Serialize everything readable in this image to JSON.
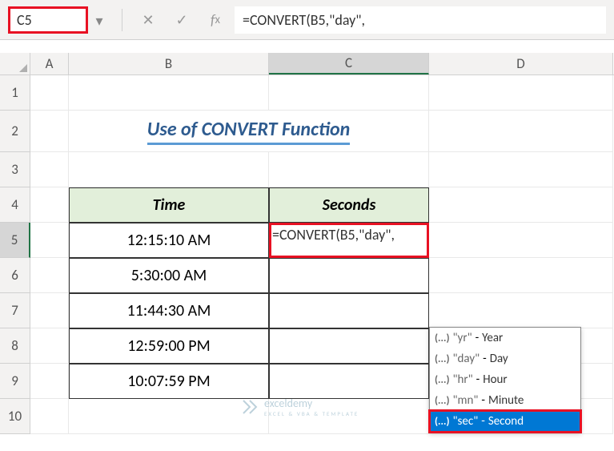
{
  "name_box": "C5",
  "formula_bar": "=CONVERT(B5,\"day\",",
  "columns": {
    "a": "A",
    "b": "B",
    "c": "C",
    "d": "D"
  },
  "rows": {
    "r1": "1",
    "r2": "2",
    "r3": "3",
    "r4": "4",
    "r5": "5",
    "r6": "6",
    "r7": "7",
    "r8": "8",
    "r9": "9",
    "r10": "10"
  },
  "title": "Use of CONVERT Function",
  "table": {
    "headers": {
      "time": "Time",
      "seconds": "Seconds"
    },
    "rows": [
      {
        "time": "12:15:10 AM",
        "seconds": ""
      },
      {
        "time": "5:30:00 AM",
        "seconds": ""
      },
      {
        "time": "11:44:30 AM",
        "seconds": ""
      },
      {
        "time": "12:59:00 PM",
        "seconds": ""
      },
      {
        "time": "10:07:59 PM",
        "seconds": ""
      }
    ]
  },
  "active_formula": "=CONVERT(B5,\"day\",",
  "autocomplete": {
    "items": [
      {
        "value": "\"yr\"",
        "label": "Year"
      },
      {
        "value": "\"day\"",
        "label": "Day"
      },
      {
        "value": "\"hr\"",
        "label": "Hour"
      },
      {
        "value": "\"mn\"",
        "label": "Minute"
      },
      {
        "value": "\"sec\"",
        "label": "Second"
      }
    ],
    "icon": "(...)",
    "selected_index": 4
  },
  "watermark": {
    "name": "exceldemy",
    "sub": "EXCEL & VBA & TEMPLATE"
  }
}
